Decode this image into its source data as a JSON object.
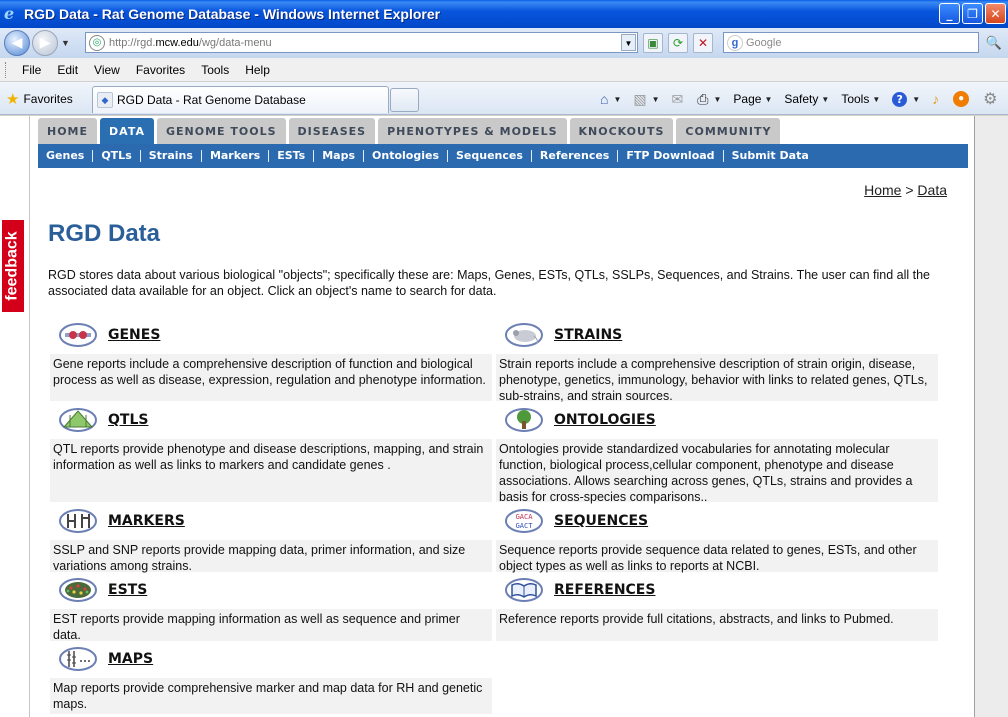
{
  "window": {
    "title": "RGD Data - Rat Genome Database - Windows Internet Explorer"
  },
  "address": {
    "url_prefix": "http://rgd.",
    "url_domain": "mcw.edu",
    "url_path": "/wg/data-menu",
    "search_placeholder": "Google"
  },
  "menubar": [
    "File",
    "Edit",
    "View",
    "Favorites",
    "Tools",
    "Help"
  ],
  "favorites": {
    "label": "Favorites",
    "tab_title": "RGD Data - Rat Genome Database"
  },
  "commandbar": {
    "page": "Page",
    "safety": "Safety",
    "tools": "Tools"
  },
  "feedback_tab": "feedback",
  "site": {
    "top_nav": [
      "HOME",
      "DATA",
      "GENOME TOOLS",
      "DISEASES",
      "PHENOTYPES & MODELS",
      "KNOCKOUTS",
      "COMMUNITY"
    ],
    "active_top": "DATA",
    "sub_nav": [
      "Genes",
      "QTLs",
      "Strains",
      "Markers",
      "ESTs",
      "Maps",
      "Ontologies",
      "Sequences",
      "References",
      "FTP Download",
      "Submit Data"
    ],
    "breadcrumb": {
      "home": "Home",
      "separator": " > ",
      "current": "Data"
    },
    "page_title": "RGD Data",
    "intro": "RGD stores data about various biological \"objects\"; specifically these are: Maps, Genes, ESTs, QTLs, SSLPs, Sequences, and Strains. The user can find all the associated data available for an object. Click an object's name to search for data."
  },
  "objects": [
    {
      "name": "GENES",
      "icon": "genes-icon",
      "desc": "Gene reports include a comprehensive description of function and biological process as well as disease, expression, regulation and phenotype information."
    },
    {
      "name": "STRAINS",
      "icon": "rat-icon",
      "desc": "Strain reports include a comprehensive description of strain origin, disease, phenotype, genetics, immunology, behavior with links to related genes, QTLs, sub-strains, and strain sources."
    },
    {
      "name": "QTLS",
      "icon": "qtl-peak-icon",
      "desc": "QTL reports provide phenotype and disease descriptions, mapping, and strain information as well as links to markers and candidate genes ."
    },
    {
      "name": "ONTOLOGIES",
      "icon": "tree-icon",
      "desc": "Ontologies provide standardized vocabularies for annotating molecular function, biological process,cellular component, phenotype and disease associations. Allows searching across genes, QTLs, strains and provides a basis for cross-species comparisons.."
    },
    {
      "name": "MARKERS",
      "icon": "markers-icon",
      "desc": "SSLP and SNP reports provide mapping data, primer information, and size variations among strains."
    },
    {
      "name": "SEQUENCES",
      "icon": "sequence-icon",
      "icon_text_top": "GACA",
      "icon_text_bottom": "GACT",
      "desc": "Sequence reports provide sequence data related to genes, ESTs, and other object types as well as links to reports at NCBI."
    },
    {
      "name": "ESTS",
      "icon": "ests-icon",
      "desc": "EST reports provide mapping information as well as sequence and primer data."
    },
    {
      "name": "REFERENCES",
      "icon": "book-icon",
      "desc": "Reference reports provide full citations, abstracts, and links to Pubmed."
    },
    {
      "name": "MAPS",
      "icon": "map-icon",
      "desc": "Map reports provide comprehensive marker and map data for RH and genetic maps."
    }
  ],
  "colors": {
    "titlebar": "#0855dd",
    "nav_active": "#2a6fb2",
    "subnav": "#2c6ab0",
    "title": "#2a5f99",
    "feedback": "#d4001a"
  }
}
